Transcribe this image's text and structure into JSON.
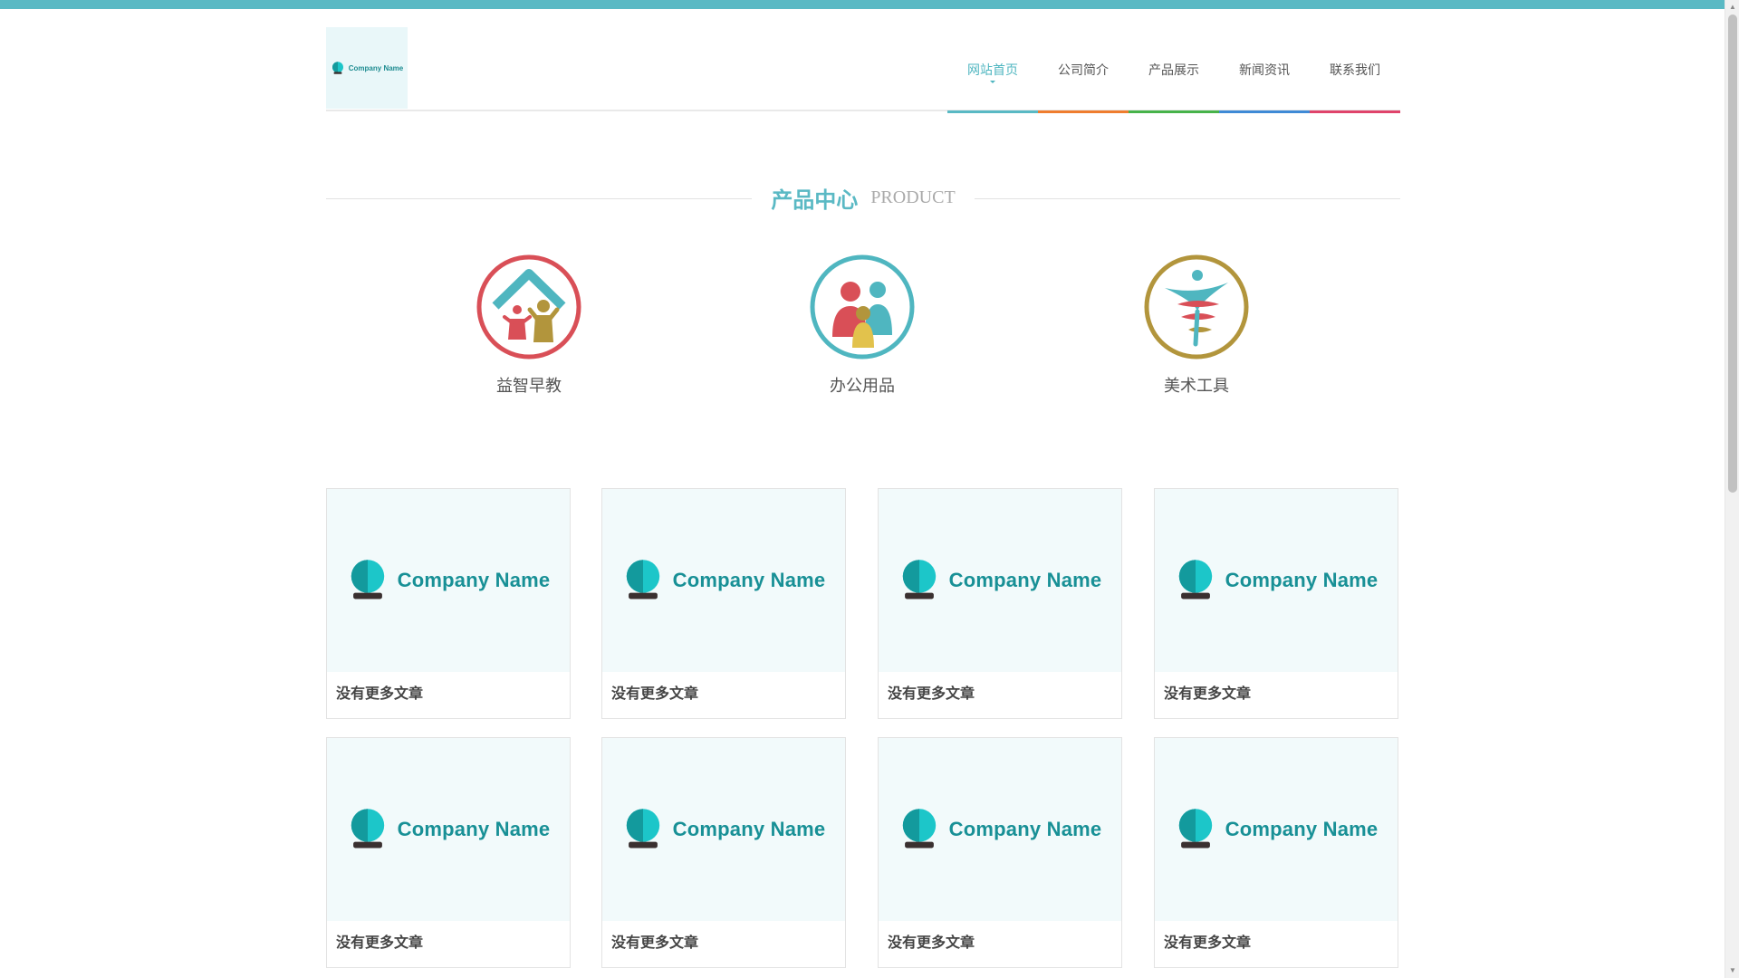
{
  "brand": {
    "logo_text": "Company Name",
    "accent_color": "#59b9c4"
  },
  "nav": {
    "items": [
      {
        "label": "网站首页",
        "active": true,
        "color": "#59b9c4"
      },
      {
        "label": "公司简介",
        "active": false,
        "color": "#ef7d2e"
      },
      {
        "label": "产品展示",
        "active": false,
        "color": "#47b34a"
      },
      {
        "label": "新闻资讯",
        "active": false,
        "color": "#3f8ad6"
      },
      {
        "label": "联系我们",
        "active": false,
        "color": "#e0436b"
      }
    ]
  },
  "section": {
    "title_cn": "产品中心",
    "title_en": "PRODUCT"
  },
  "categories": [
    {
      "label": "益智早教",
      "icon": "family-house-icon",
      "ring_color": "#d94f57"
    },
    {
      "label": "办公用品",
      "icon": "family-people-icon",
      "ring_color": "#4fb6c0"
    },
    {
      "label": "美术工具",
      "icon": "dancer-icon",
      "ring_color": "#b2953c"
    }
  ],
  "products": [
    {
      "title": "没有更多文章",
      "image_text": "Company Name"
    },
    {
      "title": "没有更多文章",
      "image_text": "Company Name"
    },
    {
      "title": "没有更多文章",
      "image_text": "Company Name"
    },
    {
      "title": "没有更多文章",
      "image_text": "Company Name"
    },
    {
      "title": "没有更多文章",
      "image_text": "Company Name"
    },
    {
      "title": "没有更多文章",
      "image_text": "Company Name"
    },
    {
      "title": "没有更多文章",
      "image_text": "Company Name"
    },
    {
      "title": "没有更多文章",
      "image_text": "Company Name"
    }
  ]
}
